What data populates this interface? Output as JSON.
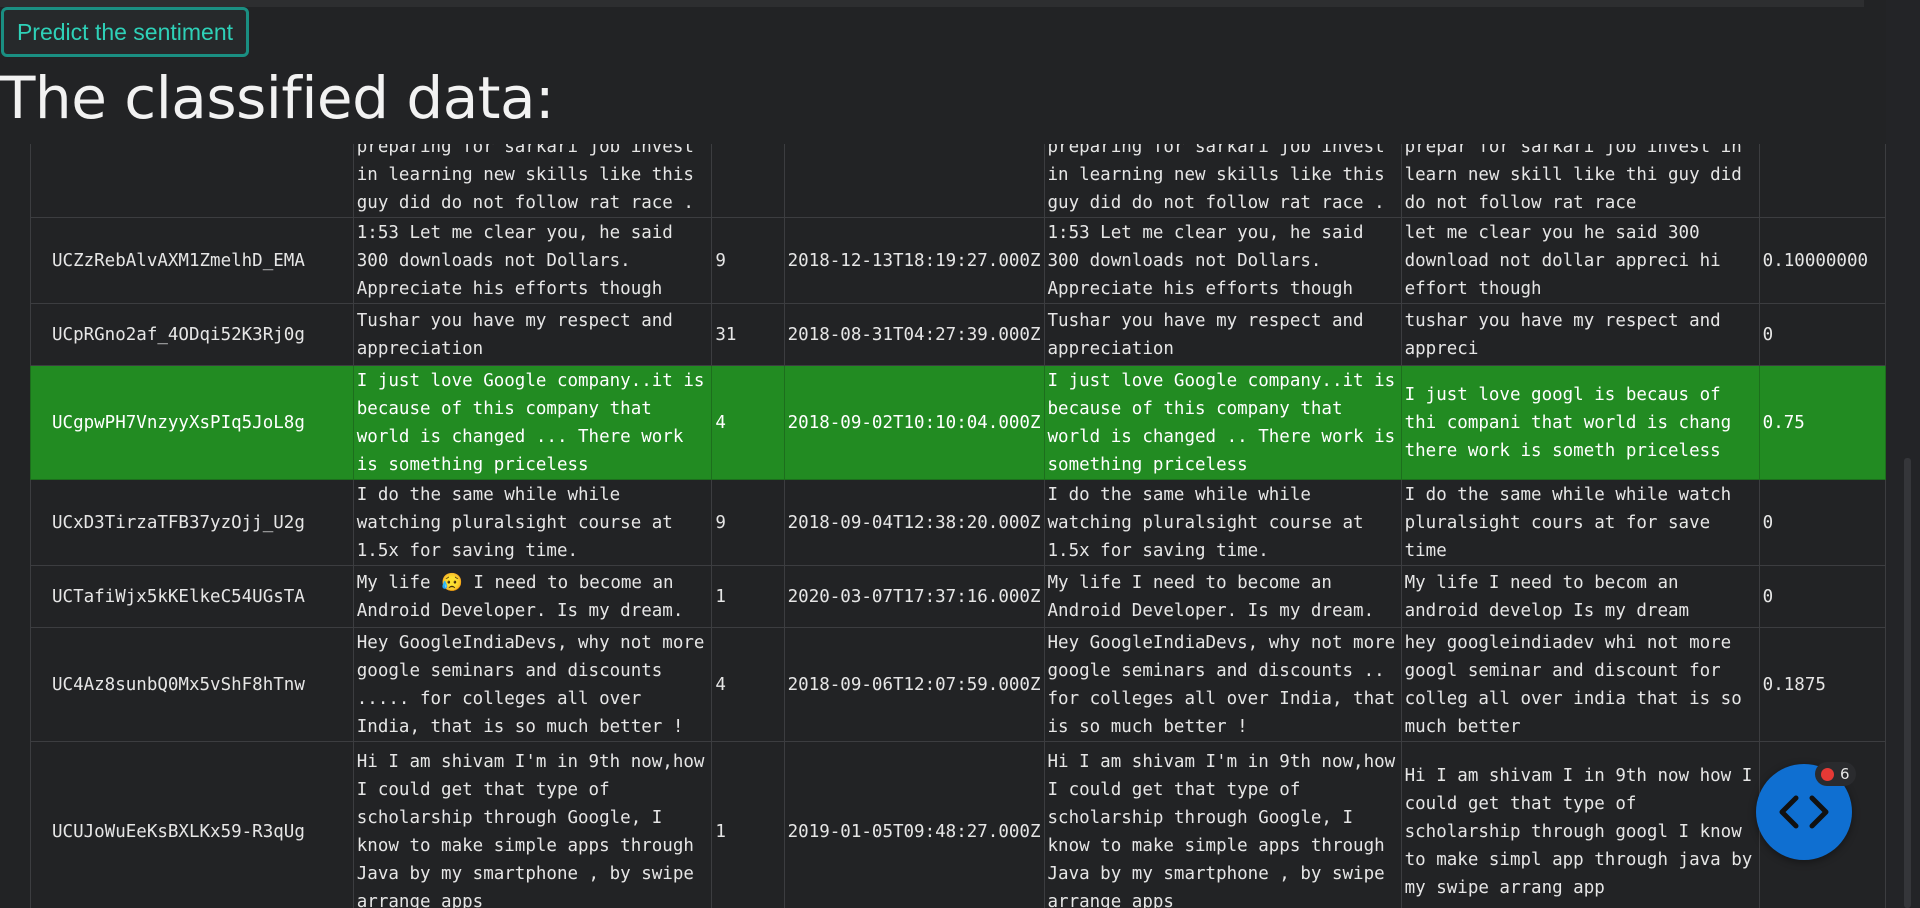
{
  "button": {
    "label": "Predict the sentiment"
  },
  "title": "The classified data:",
  "table": {
    "rows": [
      {
        "id": "",
        "comment": "preparing for sarkari job invest in learning new skills like this guy did do not follow rat race .",
        "likes": "",
        "time": "",
        "cleaned": "preparing for sarkari job invest in learning new skills like this guy did do not follow rat race .",
        "stemmed": "prepar for sarkari job invest in learn new skill like thi guy did do not follow rat race",
        "score": "",
        "highlight": false
      },
      {
        "id": "UCZzRebAlvAXM1ZmelhD_EMA",
        "comment": "1:53 Let me clear you, he said 300 downloads not Dollars. Appreciate his efforts though",
        "likes": "9",
        "time": "2018-12-13T18:19:27.000Z",
        "cleaned": "1:53 Let me clear you, he said 300 downloads not Dollars. Appreciate his efforts though",
        "stemmed": "let me clear you he said 300 download not dollar appreci hi effort though",
        "score": "0.10000000",
        "highlight": false
      },
      {
        "id": "UCpRGno2af_4ODqi52K3Rj0g",
        "comment": "Tushar you have my respect and appreciation",
        "likes": "31",
        "time": "2018-08-31T04:27:39.000Z",
        "cleaned": "Tushar you have my respect and appreciation",
        "stemmed": "tushar you have my respect and appreci",
        "score": "0",
        "highlight": false
      },
      {
        "id": "UCgpwPH7VnzyyXsPIq5JoL8g",
        "comment": "I just love Google company..it is because of this company that world is changed ... There work is something priceless",
        "likes": "4",
        "time": "2018-09-02T10:10:04.000Z",
        "cleaned": "I just love Google company..it is because of this company that world is changed .. There work is something priceless",
        "stemmed": "I just love googl is becaus of thi compani that world is chang there work is someth priceless",
        "score": "0.75",
        "highlight": true
      },
      {
        "id": "UCxD3TirzaTFB37yzOjj_U2g",
        "comment": "I do the same while while watching pluralsight course at 1.5x for saving time.",
        "likes": "9",
        "time": "2018-09-04T12:38:20.000Z",
        "cleaned": "I do the same while while watching pluralsight course at 1.5x for saving time.",
        "stemmed": "I do the same while while watch pluralsight cours at for save time",
        "score": "0",
        "highlight": false
      },
      {
        "id": "UCTafiWjx5kKElkeC54UGsTA",
        "comment": "My life 😥 I need to become an Android Developer. Is my dream.",
        "likes": "1",
        "time": "2020-03-07T17:37:16.000Z",
        "cleaned": "My life I need to become an Android Developer. Is my dream.",
        "stemmed": "My life I need to becom an android develop Is my dream",
        "score": "0",
        "highlight": false
      },
      {
        "id": "UC4Az8sunbQ0Mx5vShF8hTnw",
        "comment": "Hey GoogleIndiaDevs, why not more google seminars and discounts ..... for colleges all over India, that is so much better !",
        "likes": "4",
        "time": "2018-09-06T12:07:59.000Z",
        "cleaned": "Hey GoogleIndiaDevs, why not more google seminars and discounts .. for colleges all over India, that is so much better !",
        "stemmed": "hey googleindiadev whi not more googl seminar and discount for colleg all over india that is so much better",
        "score": "0.1875",
        "highlight": false
      },
      {
        "id": "UCUJoWuEeKsBXLKx59-R3qUg",
        "comment": "Hi I am shivam I'm in 9th now,how I could get that type of scholarship through Google, I know to make simple apps through Java by my smartphone , by swipe arrange apps",
        "likes": "1",
        "time": "2019-01-05T09:48:27.000Z",
        "cleaned": "Hi I am shivam I'm in 9th now,how I could get that type of scholarship through Google, I know to make simple apps through Java by my smartphone , by swipe arrange apps",
        "stemmed": "Hi I am shivam I in 9th now how I could get that type of scholarship through googl I know to make simpl app through java by my swipe arrang app",
        "score": "0",
        "highlight": false
      }
    ]
  },
  "widget": {
    "badge_count": "6",
    "icon": "code-brackets-icon"
  }
}
